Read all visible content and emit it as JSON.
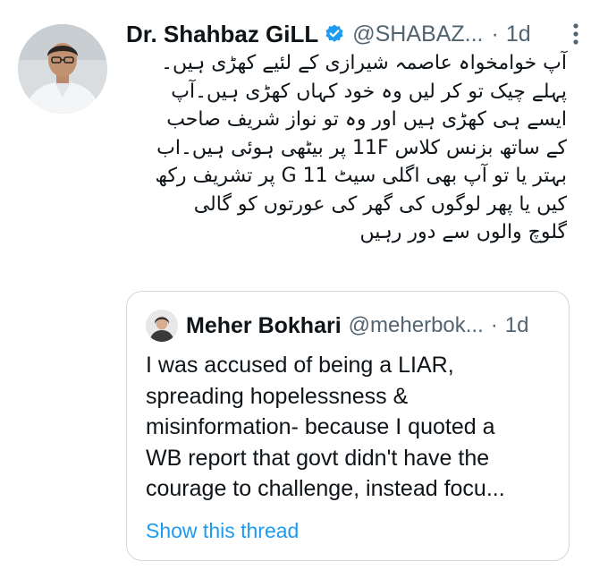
{
  "tweet": {
    "author": {
      "display_name": "Dr. Shahbaz GiLL",
      "handle": "@SHABAZ...",
      "verified": true,
      "avatar_icon": "profile-photo"
    },
    "separator": "·",
    "time": "1d",
    "more_icon": "vertical-ellipsis-icon",
    "text_lines": [
      "آپ خوامخواہ عاصمہ شیرازی کے لئیے کھڑی ہیں۔",
      "پہلے چیک تو کر لیں وہ خود کہاں کھڑی ہیں۔آپ",
      "ایسے ہی کھڑی ہیں اور وہ تو نواز شریف صاحب",
      "کے ساتھ بزنس کلاس 11F پر بیٹھی ہوئی ہیں۔اب",
      "بہتر یا تو آپ بھی اگلی سیٹ G 11 پر تشریف رکھ",
      "کیں یا پھر لوگوں کی گھر کی عورتوں کو گالی",
      "گلوچ والوں سے دور رہیں"
    ]
  },
  "quoted_tweet": {
    "author": {
      "display_name": "Meher Bokhari",
      "handle": "@meherbok...",
      "avatar_icon": "profile-photo"
    },
    "separator": "·",
    "time": "1d",
    "text_lines": [
      "I was accused of being a LIAR,",
      "spreading hopelessness &",
      "misinformation- because I quoted a",
      "WB report that govt didn't have the",
      "courage to challenge, instead focu..."
    ],
    "show_thread_label": "Show this thread"
  },
  "colors": {
    "text_primary": "#0f1419",
    "text_secondary": "#536471",
    "link": "#1d9bf0",
    "verified_badge": "#1d9bf0",
    "border": "#cfd9de"
  }
}
